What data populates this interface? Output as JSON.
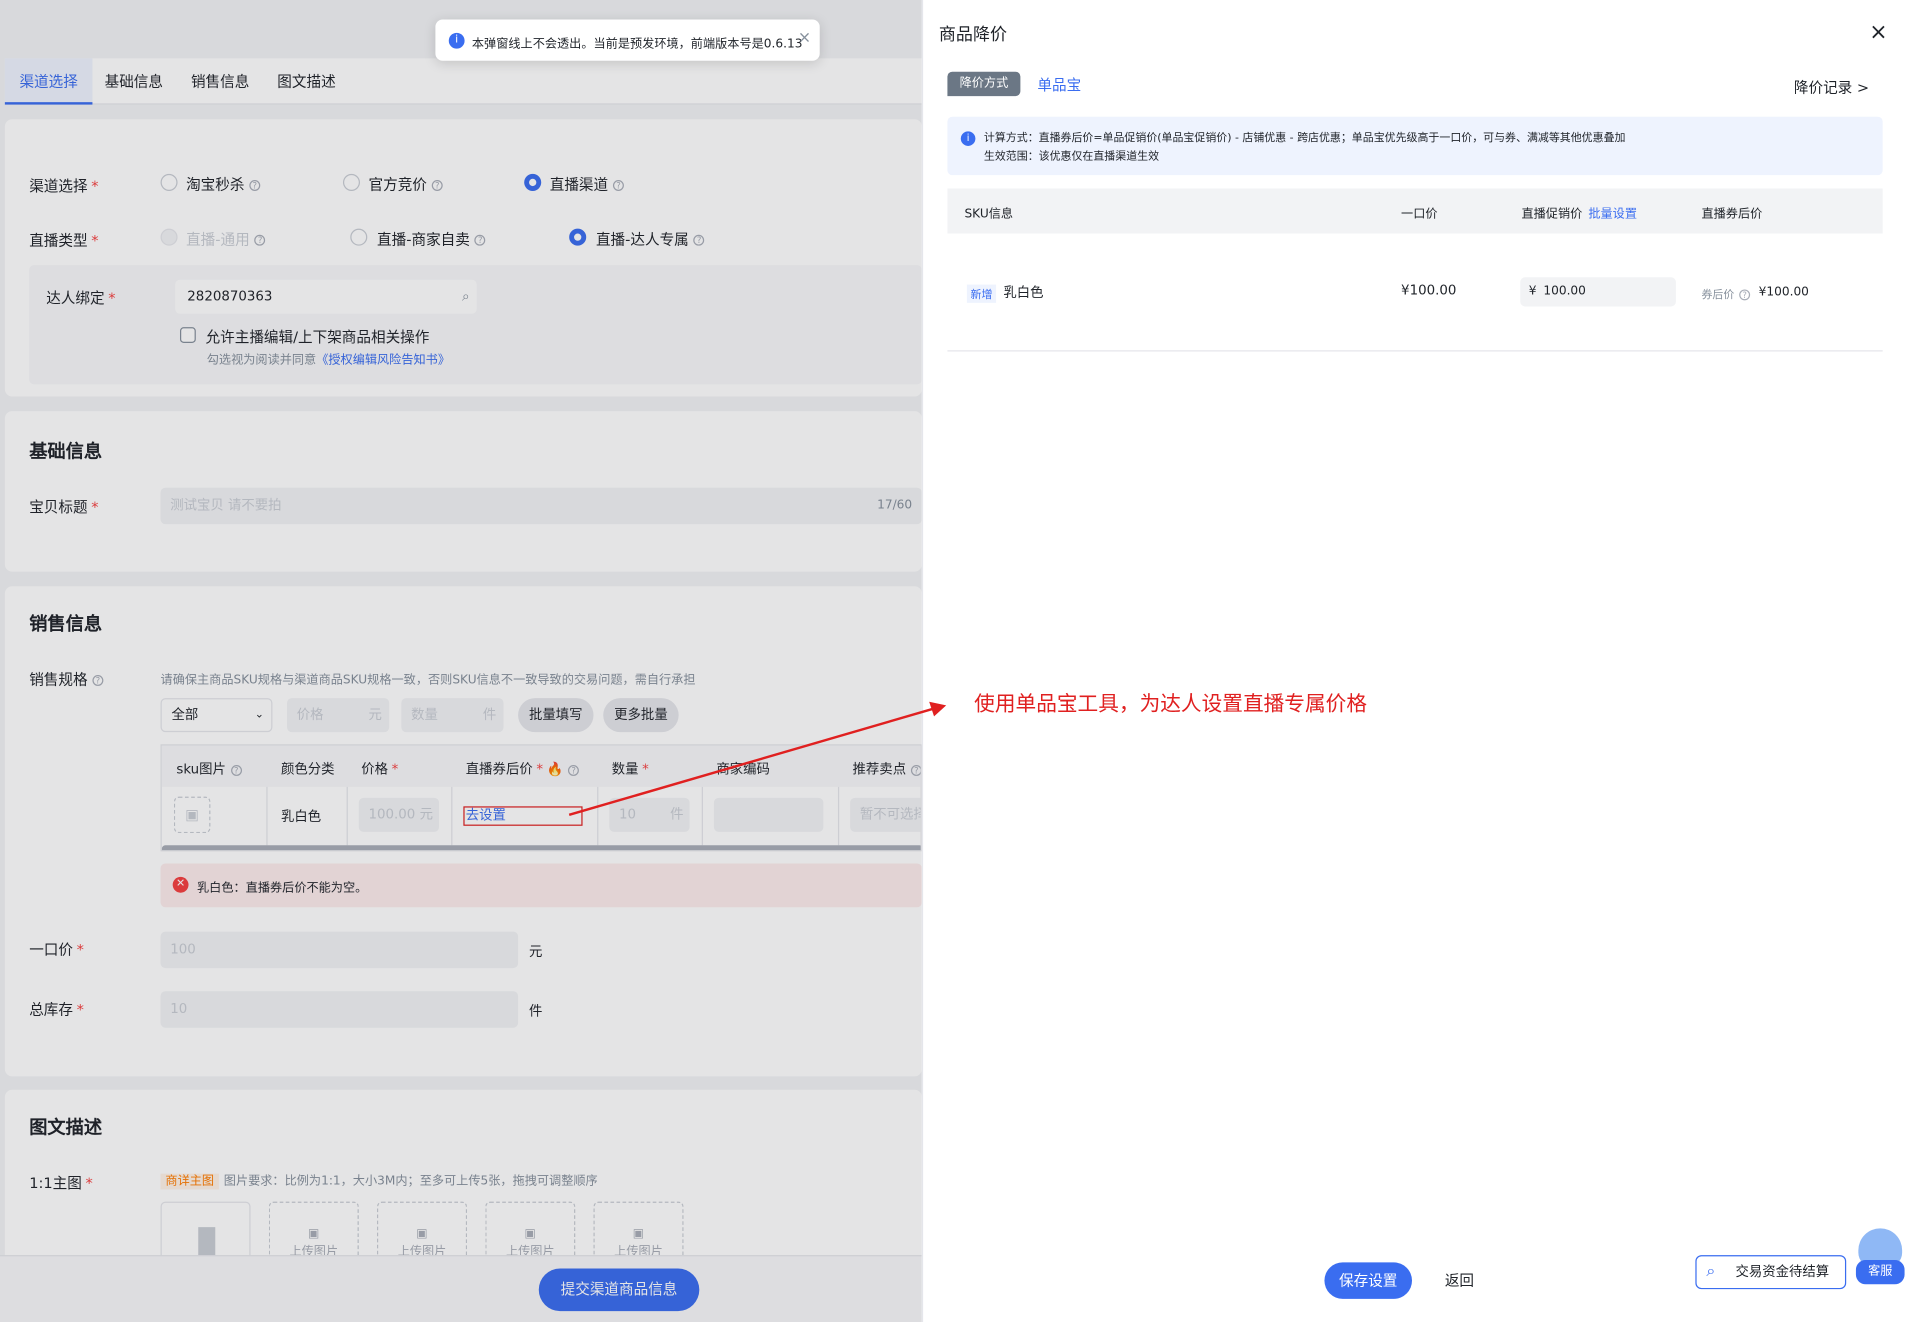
{
  "toast": {
    "text": "本弹窗线上不会透出。当前是预发环境，前端版本号是0.6.13"
  },
  "tabs": [
    "渠道选择",
    "基础信息",
    "销售信息",
    "图文描述"
  ],
  "channel": {
    "label": "渠道选择",
    "options": [
      "淘宝秒杀",
      "官方竞价",
      "直播渠道"
    ],
    "live_type_label": "直播类型",
    "live_types": [
      "直播-通用",
      "直播-商家自卖",
      "直播-达人专属"
    ],
    "bind_label": "达人绑定",
    "bind_value": "2820870363",
    "allow_label": "允许主播编辑/上下架商品相关操作",
    "agree_prefix": "勾选视为阅读并同意",
    "agree_link": "《授权编辑风险告知书》"
  },
  "basic": {
    "title": "基础信息",
    "item_title_label": "宝贝标题",
    "item_title_value": "测试宝贝 请不要拍",
    "count": "17/60"
  },
  "sales": {
    "title": "销售信息",
    "spec_label": "销售规格",
    "spec_hint": "请确保主商品SKU规格与渠道商品SKU规格一致，否则SKU信息不一致导致的交易问题，需自行承担",
    "filter_all": "全部",
    "price_ph": "价格",
    "price_unit": "元",
    "qty_ph": "数量",
    "qty_unit": "件",
    "batch_fill": "批量填写",
    "more_batch": "更多批量",
    "headers": [
      "sku图片",
      "颜色分类",
      "价格",
      "直播券后价",
      "数量",
      "商家编码",
      "推荐卖点"
    ],
    "row": {
      "color": "乳白色",
      "price": "100.00",
      "price_unit": "元",
      "set": "去设置",
      "qty": "10",
      "qty_unit": "件",
      "point": "暂不可选择"
    },
    "error": "乳白色：直播券后价不能为空。",
    "fixed_label": "一口价",
    "fixed_value": "100",
    "fixed_unit": "元",
    "stock_label": "总库存",
    "stock_value": "10",
    "stock_unit": "件"
  },
  "desc": {
    "title": "图文描述",
    "main_label": "1:1主图",
    "tag": "商详主图",
    "hint": "图片要求：比例为1:1，大小3M内；至多可上传5张，拖拽可调整顺序",
    "upload": "上传图片"
  },
  "submit": "提交渠道商品信息",
  "drawer": {
    "title": "商品降价",
    "method_tag": "降价方式",
    "method_value": "单品宝",
    "record": "降价记录 >",
    "info_line1": "计算方式：直播券后价=单品促销价(单品宝促销价) - 店铺优惠 - 跨店优惠；单品宝优先级高于一口价，可与券、满减等其他优惠叠加",
    "info_line2": "生效范围：该优惠仅在直播渠道生效",
    "headers": {
      "sku": "SKU信息",
      "price": "一口价",
      "promo": "直播促销价",
      "batch": "批量设置",
      "after": "直播券后价"
    },
    "row": {
      "tag": "新增",
      "name": "乳白色",
      "price": "¥100.00",
      "currency": "¥",
      "promo": "100.00",
      "after_label": "券后价",
      "after_value": "¥100.00"
    },
    "save": "保存设置",
    "back": "返回"
  },
  "annotation": "使用单品宝工具，为达人设置直播专属价格",
  "float": {
    "search": "交易资金待结算",
    "service": "客服"
  }
}
